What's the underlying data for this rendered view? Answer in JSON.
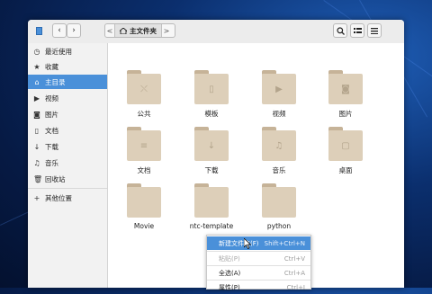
{
  "toolbar": {
    "back_icon": "chevron-left",
    "forward_icon": "chevron-right",
    "breadcrumb": {
      "prev_arrow": "<",
      "home_label": "主文件夹",
      "next_arrow": ">"
    },
    "search_icon": "search-icon",
    "view_toggle_icon": "list-view-icon",
    "menu_icon": "hamburger-menu-icon"
  },
  "sidebar": {
    "items": [
      {
        "label": "最近使用",
        "icon": "clock"
      },
      {
        "label": "收藏",
        "icon": "star"
      },
      {
        "label": "主目录",
        "icon": "home",
        "active": true
      },
      {
        "label": "视频",
        "icon": "video"
      },
      {
        "label": "图片",
        "icon": "camera"
      },
      {
        "label": "文档",
        "icon": "document"
      },
      {
        "label": "下载",
        "icon": "download"
      },
      {
        "label": "音乐",
        "icon": "music"
      },
      {
        "label": "回收站",
        "icon": "trash"
      },
      {
        "label": "其他位置",
        "icon": "plus"
      }
    ]
  },
  "folders": [
    {
      "label": "公共",
      "emblem": "share"
    },
    {
      "label": "模板",
      "emblem": "template"
    },
    {
      "label": "视频",
      "emblem": "video"
    },
    {
      "label": "图片",
      "emblem": "camera"
    },
    {
      "label": "文档",
      "emblem": "document"
    },
    {
      "label": "下载",
      "emblem": "download"
    },
    {
      "label": "音乐",
      "emblem": "music"
    },
    {
      "label": "桌面",
      "emblem": "desktop"
    },
    {
      "label": "Movie",
      "emblem": ""
    },
    {
      "label": "ntc-template",
      "emblem": ""
    },
    {
      "label": "python",
      "emblem": ""
    }
  ],
  "context_menu": {
    "items": [
      {
        "label": "新建文件夹(F)",
        "shortcut": "Shift+Ctrl+N",
        "highlighted": true
      },
      {
        "label": "粘贴(P)",
        "shortcut": "Ctrl+V",
        "disabled": true
      },
      {
        "label": "全选(A)",
        "shortcut": "Ctrl+A"
      },
      {
        "label": "属性(P)",
        "shortcut": "Ctrl+I"
      }
    ]
  },
  "colors": {
    "accent": "#4a90d9",
    "folder": "#ddcfb9",
    "folder_tab": "#c6b398",
    "desktop_bg": "#0b2f6e"
  }
}
